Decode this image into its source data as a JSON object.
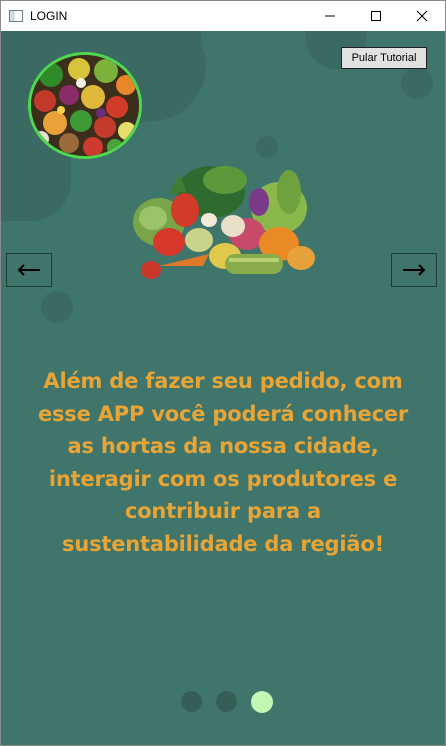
{
  "window": {
    "title": "LOGIN",
    "background": "#40756b"
  },
  "tutorial": {
    "skip_label": "Pular Tutorial",
    "prev_icon": "arrow-left-icon",
    "next_icon": "arrow-right-icon",
    "message": "Além de fazer seu pedido, com esse APP você poderá conhecer as hortas da nossa cidade, interagir com os produtores e contribuir para a sustentabilidade da região!",
    "message_color": "#e8a535",
    "page_indicator": {
      "total": 3,
      "active": 3,
      "active_color": "#c2f8b4",
      "inactive_color": "#355e56"
    }
  },
  "images": {
    "logo": "vegetables-logo",
    "hero": "vegetables-illustration"
  }
}
